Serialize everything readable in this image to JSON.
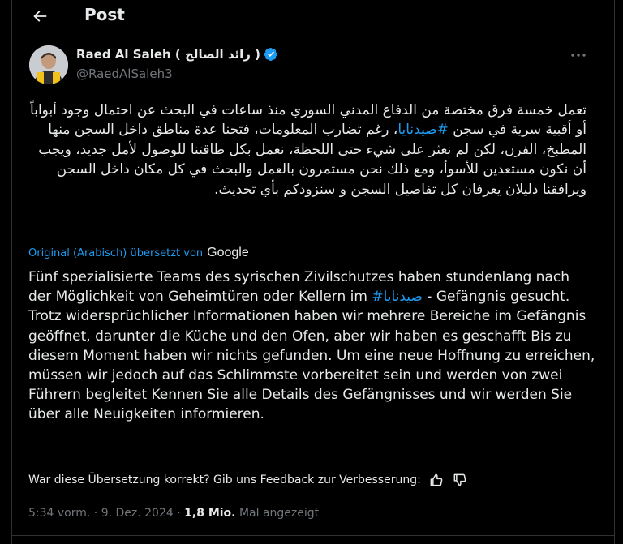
{
  "header": {
    "title": "Post"
  },
  "author": {
    "name": "Raed Al Saleh ( رائد الصالح )",
    "handle": "@RaedAlSaleh3"
  },
  "post": {
    "arabic_before": "تعمل خمسة فرق مختصة من الدفاع المدني السوري منذ ساعات في البحث عن احتمال وجود أبواباً أو أقبية سرية في سجن ",
    "arabic_hashtag": "#صيدنايا",
    "arabic_after": "، رغم تضارب المعلومات، فتحنا عدة مناطق داخل السجن منها المطبخ، الفرن، لكن لم نعثر على شيء حتى اللحظة، نعمل بكل طاقتنا للوصول لأمل جديد، ويجب أن نكون مستعدين للأسوأ، ومع ذلك نحن مستمرون بالعمل والبحث في كل مكان داخل السجن ويرافقنا دليلان يعرفان كل تفاصيل السجن و سنزودكم بأي تحديث."
  },
  "translation": {
    "label": "Original (Arabisch) übersetzt von",
    "provider": "Google",
    "text_before": "Fünf spezialisierte Teams des syrischen Zivilschutzes haben stundenlang nach der Möglichkeit von Geheimtüren oder Kellern im ",
    "hashtag": "#صيدنايا",
    "text_after": " - Gefängnis gesucht. Trotz widersprüchlicher Informationen haben wir mehrere Bereiche im Gefängnis geöffnet, darunter die Küche und den Ofen, aber wir haben es geschafft Bis zu diesem Moment haben wir nichts gefunden. Um eine neue Hoffnung zu erreichen, müssen wir jedoch auf das Schlimmste vorbereitet sein und werden von zwei Führern begleitet Kennen Sie alle Details des Gefängnisses und wir werden Sie über alle Neuigkeiten informieren."
  },
  "feedback": {
    "question": "War diese Übersetzung korrekt? Gib uns Feedback zur Verbesserung:"
  },
  "meta": {
    "time": "5:34 vorm.",
    "separator": " · ",
    "date": "9. Dez. 2024",
    "views_count": "1,8 Mio.",
    "views_label": " Mal angezeigt"
  },
  "colors": {
    "background": "#000000",
    "text": "#e7e9ea",
    "secondary": "#71767b",
    "accent": "#1d9bf0"
  }
}
